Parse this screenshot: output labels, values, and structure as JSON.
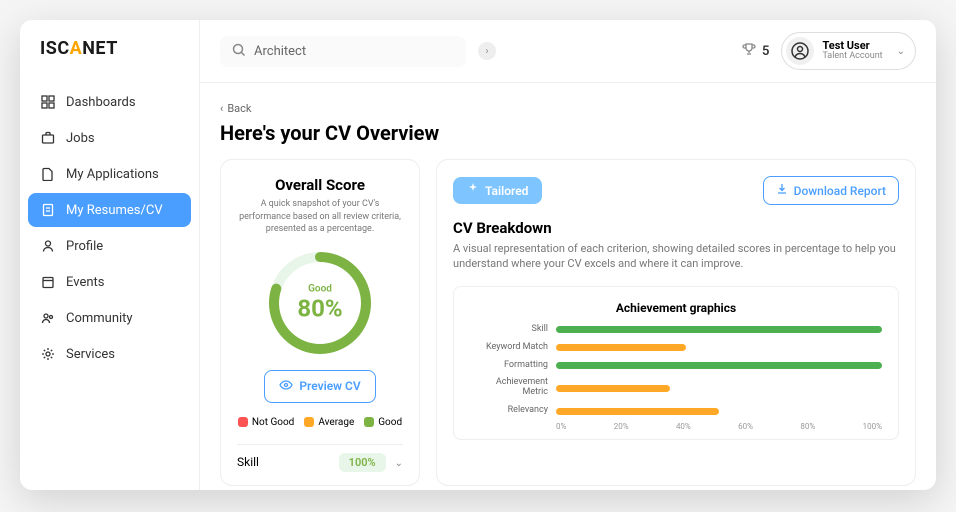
{
  "brand": {
    "part1": "ISC",
    "accent": "A",
    "part2": "NET"
  },
  "search": {
    "value": "Architect"
  },
  "points": {
    "value": "5"
  },
  "user": {
    "name": "Test User",
    "role": "Talent Account"
  },
  "nav": {
    "items": [
      {
        "label": "Dashboards"
      },
      {
        "label": "Jobs"
      },
      {
        "label": "My Applications"
      },
      {
        "label": "My Resumes/CV"
      },
      {
        "label": "Profile"
      },
      {
        "label": "Events"
      },
      {
        "label": "Community"
      },
      {
        "label": "Services"
      }
    ]
  },
  "back_label": "Back",
  "page_title": "Here's your CV Overview",
  "score": {
    "title": "Overall Score",
    "desc": "A quick snapshot of your CV's performance based on all review criteria, presented as a percentage.",
    "label": "Good",
    "pct": "80%",
    "preview_btn": "Preview CV",
    "legend": {
      "not_good": "Not Good",
      "average": "Average",
      "good": "Good"
    },
    "skill_row": {
      "label": "Skill",
      "pct": "100%"
    }
  },
  "breakdown": {
    "pill": "Tailored",
    "download": "Download  Report",
    "title": "CV Breakdown",
    "desc": "A visual representation of each criterion, showing detailed scores in percentage to help you understand where your CV excels and where it can improve."
  },
  "chart_data": {
    "type": "bar",
    "title": "Achievement graphics",
    "xlabel": "",
    "ylabel": "",
    "ylim": [
      0,
      100
    ],
    "categories": [
      "Skill",
      "Keyword Match",
      "Formatting",
      "Achievement Metric",
      "Relevancy"
    ],
    "values": [
      100,
      40,
      100,
      35,
      50
    ],
    "colors": [
      "g",
      "o",
      "g",
      "o",
      "o"
    ],
    "ticks": [
      "0%",
      "20%",
      "40%",
      "60%",
      "80%",
      "100%"
    ]
  }
}
